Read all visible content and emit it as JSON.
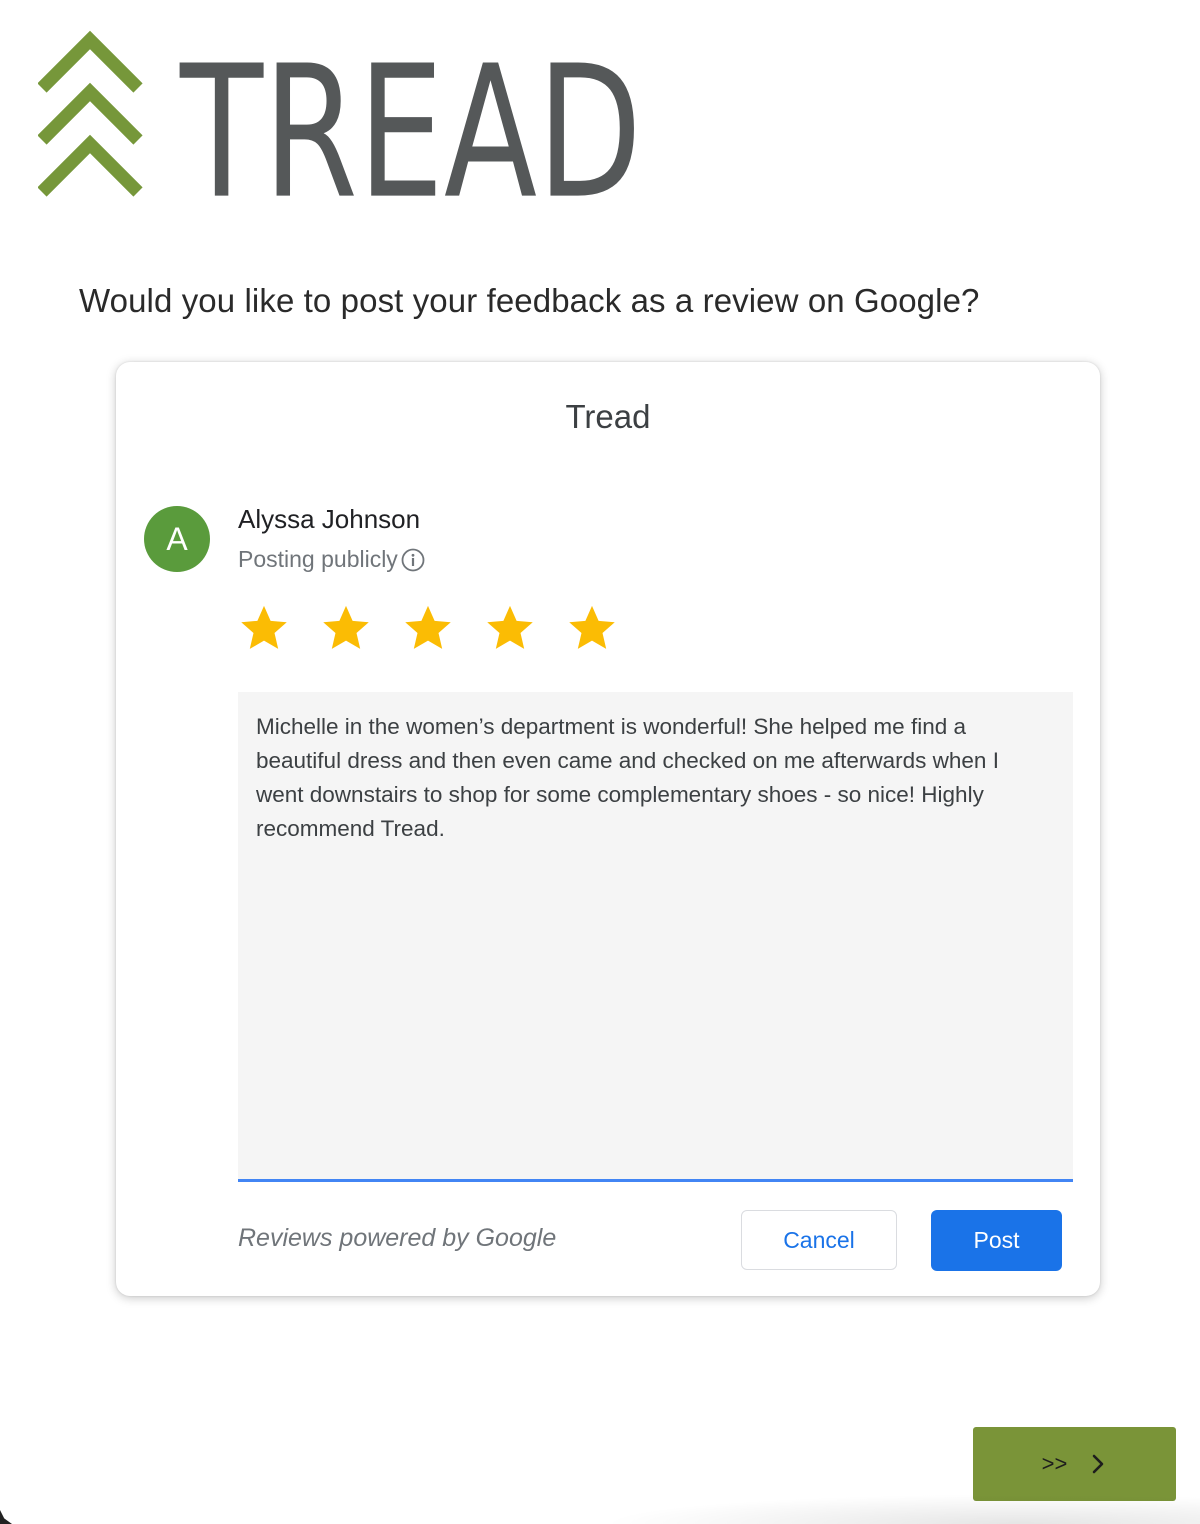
{
  "logo": {
    "wordmark": "TREAD",
    "mark_icon": "triple-chevron-up-icon",
    "colors": {
      "mark": "#76973a",
      "wordmark": "#555859"
    }
  },
  "question": "Would you like to post your feedback as a review on Google?",
  "card": {
    "title": "Tread",
    "user": {
      "avatar_letter": "A",
      "avatar_color": "#5a9b3c",
      "name": "Alyssa Johnson",
      "posting_status": "Posting publicly",
      "info_icon": "info-circle-icon"
    },
    "rating": {
      "stars_filled": 5,
      "stars_total": 5,
      "star_color": "#fbbc04"
    },
    "review_text": "Michelle in the women’s department is wonderful! She helped me find a\nbeautiful dress and then even came and checked on me afterwards when I\nwent downstairs to shop for some complementary shoes - so nice! Highly\nrecommend Tread.",
    "footer_note": "Reviews powered by Google",
    "cancel_label": "Cancel",
    "post_label": "Post",
    "accent_color": "#1a73e8"
  },
  "next_button": {
    "label": ">>",
    "icon": "chevron-right-icon",
    "color": "#7a9438"
  }
}
